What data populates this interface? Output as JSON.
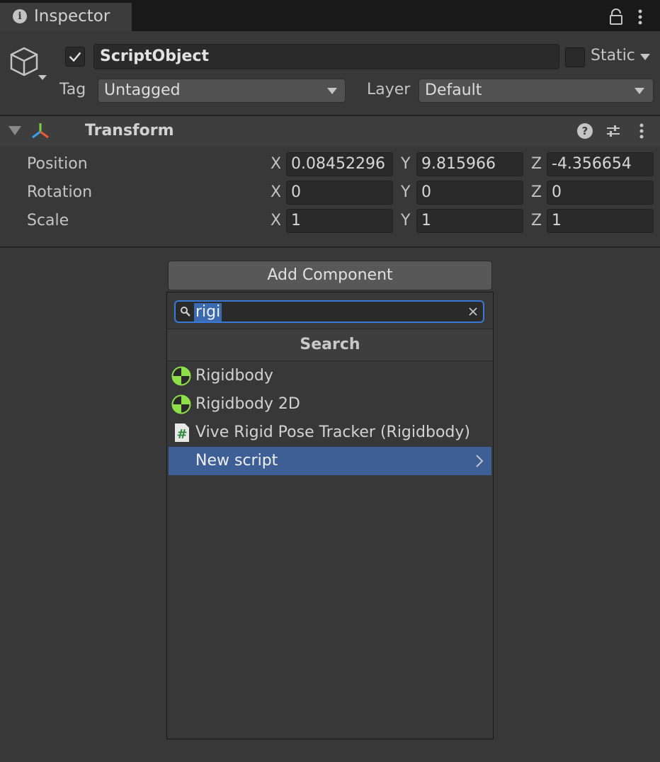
{
  "window": {
    "tab_title": "Inspector"
  },
  "object": {
    "enabled": true,
    "name": "ScriptObject",
    "static_label": "Static",
    "static_checked": false
  },
  "tag": {
    "label": "Tag",
    "value": "Untagged"
  },
  "layer": {
    "label": "Layer",
    "value": "Default"
  },
  "transform": {
    "title": "Transform",
    "rows": [
      {
        "label": "Position",
        "x": "0.08452296",
        "y": "9.815966",
        "z": "-4.356654"
      },
      {
        "label": "Rotation",
        "x": "0",
        "y": "0",
        "z": "0"
      },
      {
        "label": "Scale",
        "x": "1",
        "y": "1",
        "z": "1"
      }
    ],
    "axis_labels": {
      "x": "X",
      "y": "Y",
      "z": "Z"
    }
  },
  "add_component": {
    "button_label": "Add Component",
    "search_value": "rigi",
    "results_header": "Search",
    "results": [
      {
        "label": "Rigidbody",
        "icon": "rigidbody-icon"
      },
      {
        "label": "Rigidbody 2D",
        "icon": "rigidbody-icon"
      },
      {
        "label": "Vive Rigid Pose Tracker (Rigidbody)",
        "icon": "script-icon"
      }
    ],
    "new_script_label": "New script"
  },
  "colors": {
    "accent": "#3a7ad6",
    "selection": "#3e5f96",
    "background": "#383838"
  }
}
